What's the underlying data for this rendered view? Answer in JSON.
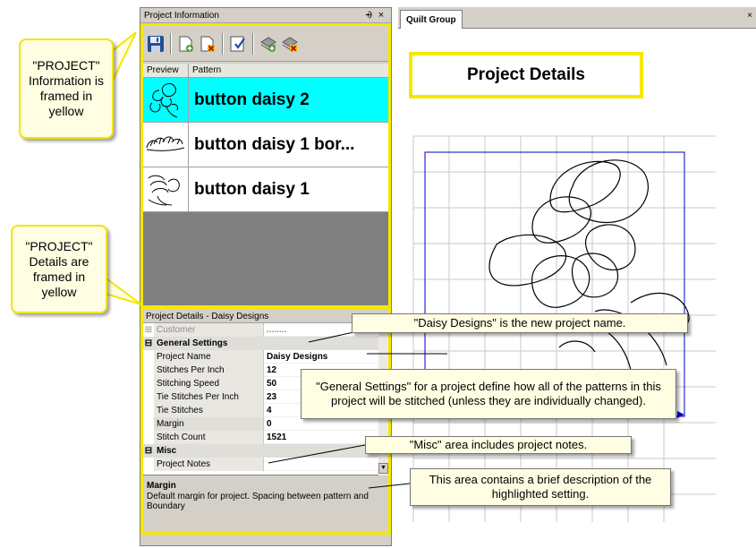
{
  "project_info_pane": {
    "title": "Project Information",
    "pin_glyph": "⨮",
    "close_glyph": "×",
    "toolbar_icons": [
      "save-icon",
      "add-pattern-icon",
      "remove-pattern-icon",
      "checklist-icon",
      "add-project-icon",
      "remove-project-icon"
    ],
    "columns": [
      "Preview",
      "Pattern"
    ],
    "patterns": [
      {
        "name": "button daisy 2",
        "selected": true
      },
      {
        "name": "button daisy 1 bor...",
        "selected": false
      },
      {
        "name": "button daisy 1",
        "selected": false
      }
    ],
    "frame_color": "#f5e800",
    "selected_color": "#00ffff"
  },
  "project_details_pane": {
    "title": "Project Details - Daisy Designs",
    "rows": [
      {
        "kind": "prop",
        "expander": "⊞",
        "label": "Customer",
        "value": "........",
        "muted": true
      },
      {
        "kind": "cat",
        "expander": "⊟",
        "label": "General Settings"
      },
      {
        "kind": "prop",
        "label": "Project Name",
        "value": "Daisy Designs"
      },
      {
        "kind": "prop",
        "label": "Stitches Per Inch",
        "value": "12"
      },
      {
        "kind": "prop",
        "label": "Stitching Speed",
        "value": "50"
      },
      {
        "kind": "prop",
        "label": "Tie Stitches Per Inch",
        "value": "23"
      },
      {
        "kind": "prop",
        "label": "Tie Stitches",
        "value": "4"
      },
      {
        "kind": "prop",
        "label": "Margin",
        "value": "0",
        "highlighted": true
      },
      {
        "kind": "prop",
        "label": "Stitch Count",
        "value": "1521"
      },
      {
        "kind": "cat",
        "expander": "⊟",
        "label": "Misc"
      },
      {
        "kind": "prop",
        "label": "Project Notes",
        "value": ""
      }
    ],
    "description": {
      "title": "Margin",
      "text": "Default margin for project. Spacing between pattern and Boundary"
    },
    "dropdown_glyph": "▼"
  },
  "document": {
    "tab_label": "Quilt Group",
    "tab_close": "×",
    "heading": "Project Details"
  },
  "callouts": {
    "project_info": "\"PROJECT\" Information is framed in yellow",
    "project_details": "\"PROJECT\" Details are framed in yellow"
  },
  "notes": {
    "daisy_designs": "\"Daisy Designs\" is the new project name.",
    "general_settings": "\"General Settings\" for a project define how all of the patterns in this project will be stitched (unless they are individually changed).",
    "misc_area": "\"Misc\"  area includes project notes.",
    "description_area": "This area contains a brief description of the highlighted setting."
  }
}
